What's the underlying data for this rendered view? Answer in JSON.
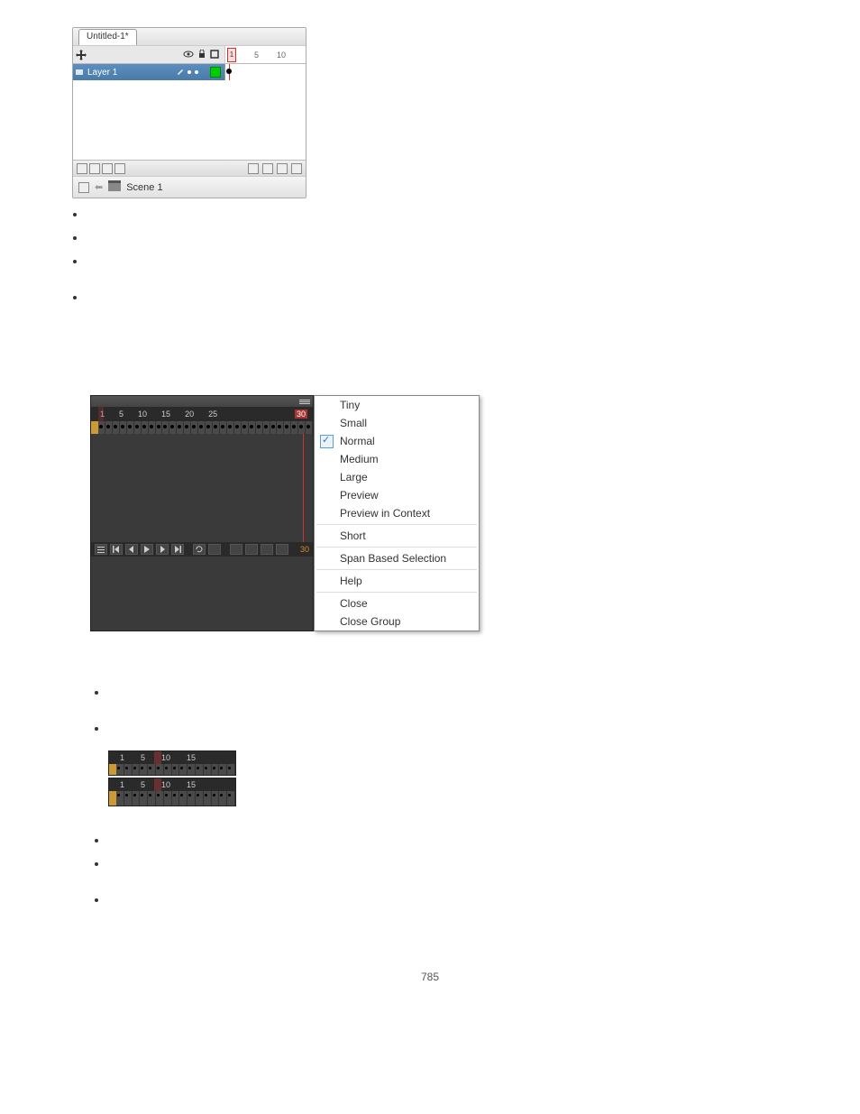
{
  "shot1": {
    "tab": "Untitled-1*",
    "layer": "Layer 1",
    "ruler": {
      "n1": "1",
      "n5": "5",
      "n10": "10"
    },
    "scene": "Scene 1"
  },
  "shot2": {
    "ruler": {
      "n1": "1",
      "n5": "5",
      "n10": "10",
      "n15": "15",
      "n20": "20",
      "n25": "25",
      "n30": "30"
    },
    "frame": "30",
    "menu": {
      "tiny": "Tiny",
      "small": "Small",
      "normal": "Normal",
      "medium": "Medium",
      "large": "Large",
      "preview": "Preview",
      "previewctx": "Preview in Context",
      "short": "Short",
      "span": "Span Based Selection",
      "help": "Help",
      "close": "Close",
      "closegrp": "Close Group"
    }
  },
  "shot3": {
    "ruler": {
      "n1": "1",
      "n5": "5",
      "n10": "10",
      "n15": "15"
    }
  },
  "pagenum": "785"
}
